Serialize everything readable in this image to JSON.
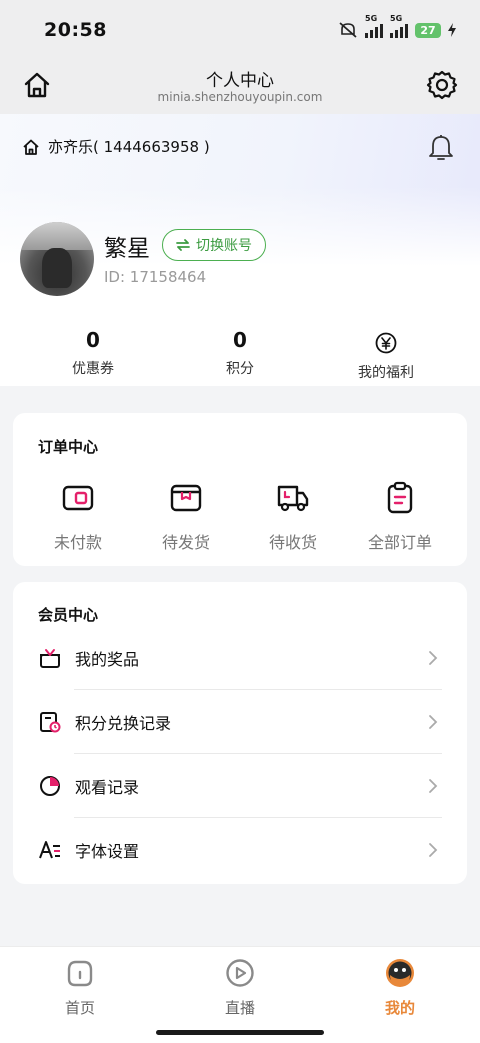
{
  "status_bar": {
    "time": "20:58",
    "net1": "5G",
    "net2": "5G",
    "battery": "27"
  },
  "header": {
    "title": "个人中心",
    "url": "minia.shenzhouyoupin.com"
  },
  "account": {
    "label": "亦齐乐( 1444663958 )"
  },
  "user": {
    "name": "繁星",
    "switch_label": "切换账号",
    "id_text": "ID: 17158464"
  },
  "stats": [
    {
      "value": "0",
      "label": "优惠券"
    },
    {
      "value": "0",
      "label": "积分"
    },
    {
      "label": "我的福利",
      "icon": "yen-icon"
    }
  ],
  "orders": {
    "title": "订单中心",
    "items": [
      {
        "label": "未付款",
        "icon": "wallet-icon"
      },
      {
        "label": "待发货",
        "icon": "package-icon"
      },
      {
        "label": "待收货",
        "icon": "truck-icon"
      },
      {
        "label": "全部订单",
        "icon": "clipboard-icon"
      }
    ]
  },
  "member": {
    "title": "会员中心",
    "items": [
      {
        "label": "我的奖品",
        "icon": "gift-icon"
      },
      {
        "label": "积分兑换记录",
        "icon": "exchange-record-icon"
      },
      {
        "label": "观看记录",
        "icon": "pie-chart-icon"
      },
      {
        "label": "字体设置",
        "icon": "font-icon"
      }
    ]
  },
  "tabbar": {
    "items": [
      {
        "label": "首页",
        "icon": "home-tab-icon",
        "active": false
      },
      {
        "label": "直播",
        "icon": "play-tab-icon",
        "active": false
      },
      {
        "label": "我的",
        "icon": "profile-tab-icon",
        "active": true
      }
    ]
  },
  "colors": {
    "accent_pink": "#e4206a",
    "accent_green": "#4caf50",
    "accent_orange": "#e8883a"
  }
}
